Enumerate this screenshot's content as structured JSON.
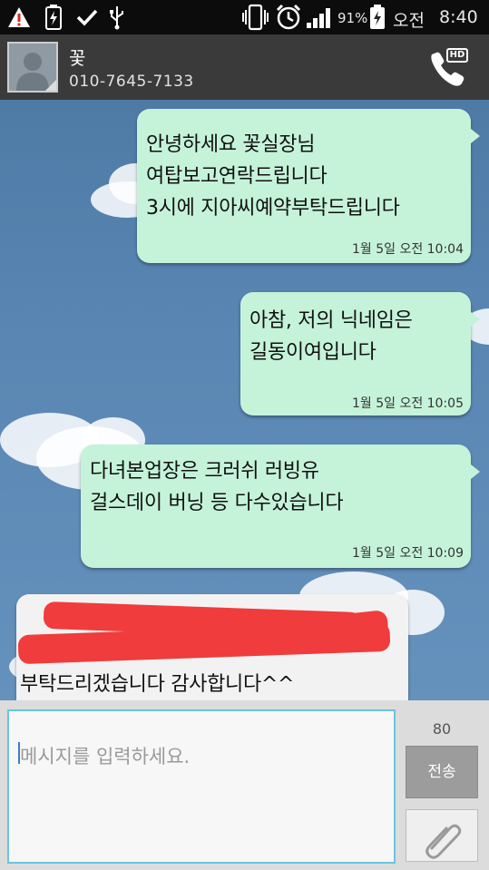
{
  "status_bar": {
    "battery_percent": "91%",
    "ampm": "오전",
    "time": "8:40"
  },
  "contact": {
    "name": "꽃",
    "number": "010-7645-7133",
    "call_badge": "HD"
  },
  "messages": [
    {
      "direction": "outgoing",
      "text": "안녕하세요 꽃실장님\n여탑보고연락드립니다\n3시에 지아씨예약부탁드립니다",
      "time": "1월 5일 오전 10:04"
    },
    {
      "direction": "outgoing",
      "text": "아참, 저의 닉네임은\n길동이여입니다",
      "time": "1월 5일 오전 10:05"
    },
    {
      "direction": "outgoing",
      "text": "다녀본업장은 크러쉬 러빙유\n걸스데이 버닝  등  다수있습니다",
      "time": "1월 5일 오전 10:09"
    },
    {
      "direction": "incoming",
      "text": "부탁드리겠습니다 감사합니다^^",
      "redacted": true
    }
  ],
  "composer": {
    "placeholder": "메시지를 입력하세요.",
    "char_count": "80",
    "send_label": "전송"
  },
  "colors": {
    "outgoing_bubble": "#c5f3d9",
    "incoming_bubble": "#f2f2f2",
    "redaction": "#f03c3c",
    "input_border": "#6cc4de"
  }
}
